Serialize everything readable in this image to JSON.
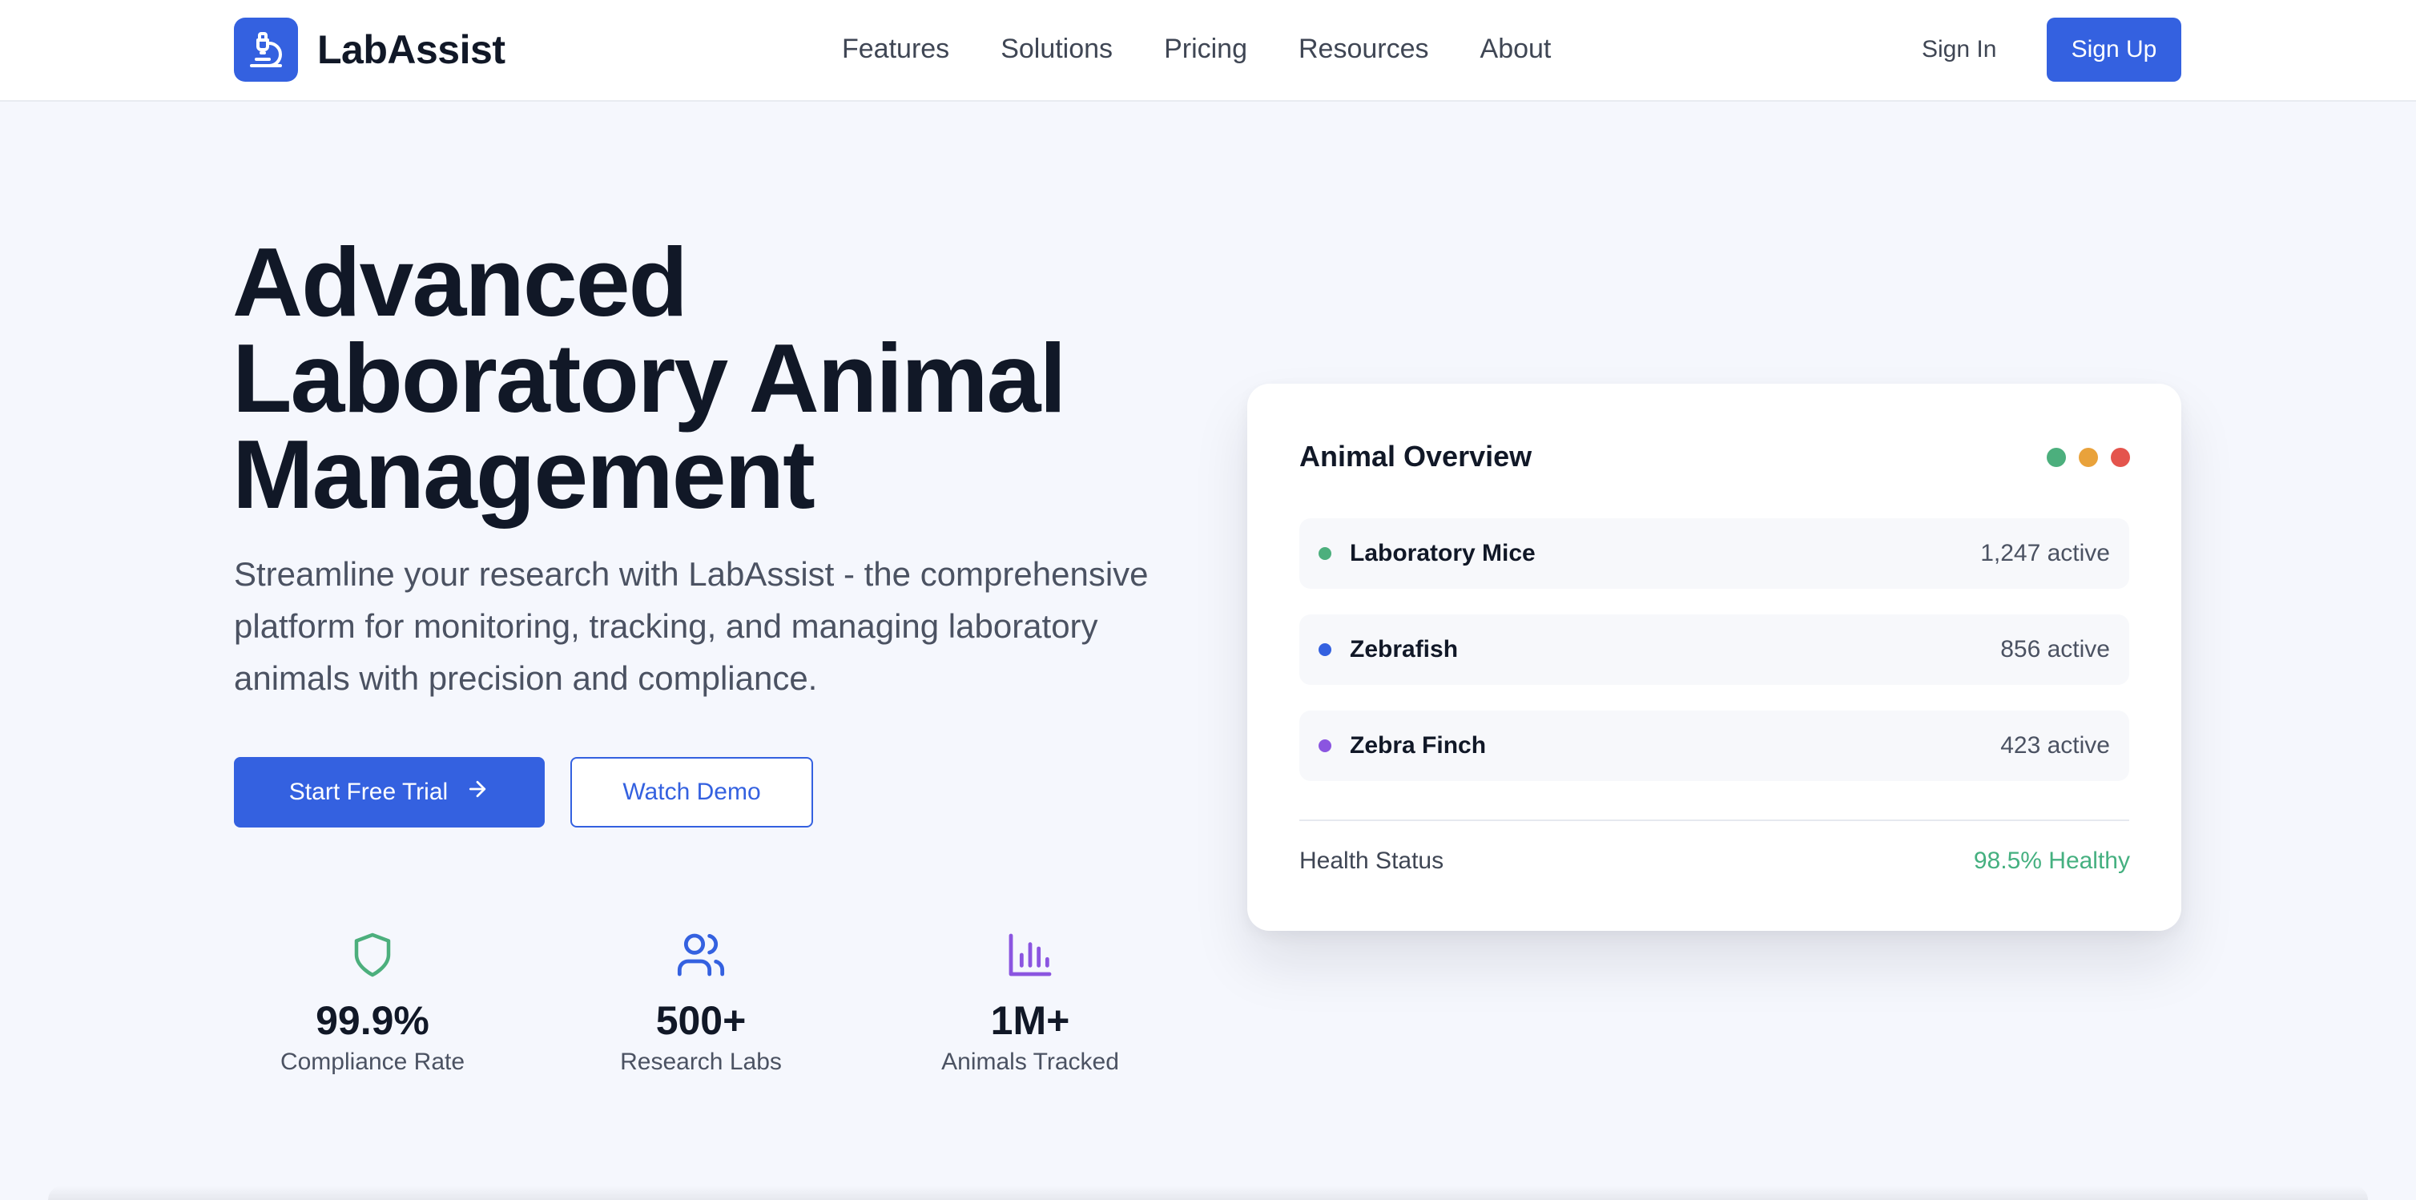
{
  "brand": {
    "name": "LabAssist",
    "logo_icon": "microscope-icon"
  },
  "nav": {
    "items": [
      "Features",
      "Solutions",
      "Pricing",
      "Resources",
      "About"
    ],
    "sign_in": "Sign In",
    "sign_up": "Sign Up"
  },
  "hero": {
    "title_lines": [
      "Advanced",
      "Laboratory Animal",
      "Management"
    ],
    "subtitle": "Streamline your research with LabAssist - the comprehensive platform for monitoring, tracking, and managing laboratory animals with precision and compliance.",
    "primary_cta": "Start Free Trial",
    "secondary_cta": "Watch Demo"
  },
  "stats": [
    {
      "icon": "shield-icon",
      "color": "#4caf7d",
      "value": "99.9%",
      "label": "Compliance Rate"
    },
    {
      "icon": "users-icon",
      "color": "#3461e0",
      "value": "500+",
      "label": "Research Labs"
    },
    {
      "icon": "bar-chart-icon",
      "color": "#8b55e0",
      "value": "1M+",
      "label": "Animals Tracked"
    }
  ],
  "overview_card": {
    "title": "Animal Overview",
    "window_dots": [
      "#4caf7d",
      "#e9a23b",
      "#e4544d"
    ],
    "rows": [
      {
        "name": "Laboratory Mice",
        "count": "1,247 active",
        "color": "#4caf7d"
      },
      {
        "name": "Zebrafish",
        "count": "856 active",
        "color": "#3461e0"
      },
      {
        "name": "Zebra Finch",
        "count": "423 active",
        "color": "#8b55e0"
      }
    ],
    "health_label": "Health Status",
    "health_value": "98.5% Healthy"
  },
  "colors": {
    "primary": "#3461e0",
    "success": "#45b080",
    "background": "#f5f7fd"
  }
}
